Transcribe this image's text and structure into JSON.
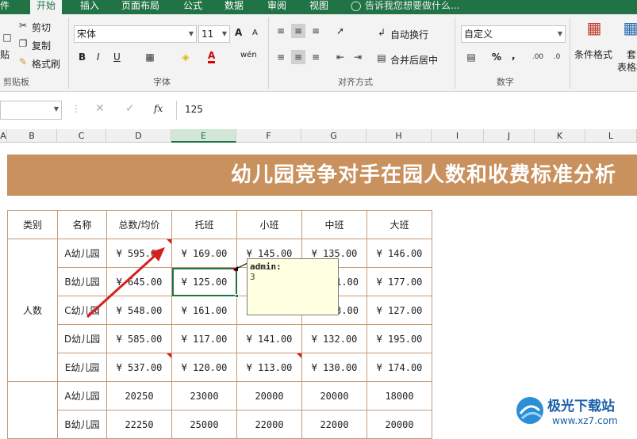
{
  "ribbon_tabs": [
    {
      "label": "件"
    },
    {
      "label": "开始",
      "active": true
    },
    {
      "label": "插入"
    },
    {
      "label": "页面布局"
    },
    {
      "label": "公式"
    },
    {
      "label": "数据"
    },
    {
      "label": "审阅"
    },
    {
      "label": "视图"
    }
  ],
  "tell_me": "告诉我您想要做什么...",
  "clipboard": {
    "cut": "剪切",
    "copy": "复制",
    "format_painter": "格式刷",
    "paste_partial": "贴",
    "group": "剪贴板"
  },
  "font": {
    "name": "宋体",
    "size": "11",
    "group": "字体",
    "bold": "B",
    "italic": "I",
    "underline": "U",
    "grow": "A",
    "shrink": "A",
    "font_color": "A",
    "phonetic": "wén"
  },
  "alignment": {
    "wrap": "自动换行",
    "merge": "合并后居中",
    "group": "对齐方式"
  },
  "number": {
    "format": "自定义",
    "group": "数字",
    "percent": "%",
    "comma": ","
  },
  "styles": {
    "conditional": "条件格式",
    "table_partial": "套",
    "table_partial2": "表格格"
  },
  "formula_bar": {
    "name_box": "",
    "value": "125",
    "fx": "fx"
  },
  "columns": [
    "A",
    "B",
    "C",
    "D",
    "E",
    "F",
    "G",
    "H",
    "I",
    "J",
    "K",
    "L"
  ],
  "banner_title": "幼儿园竞争对手在园人数和收费标准分析",
  "table": {
    "headers": [
      "类别",
      "名称",
      "总数/均价",
      "托班",
      "小班",
      "中班",
      "大班"
    ],
    "group1": "人数",
    "rows": [
      {
        "name": "A幼儿园",
        "total": "¥ 595.00",
        "c1": "¥ 169.00",
        "c2": "¥ 145.00",
        "c3": "¥ 135.00",
        "c4": "¥ 146.00"
      },
      {
        "name": "B幼儿园",
        "total": "¥ 645.00",
        "c1": "¥ 125.00",
        "c2": "",
        "c3": "1.00",
        "c4": "¥ 177.00"
      },
      {
        "name": "C幼儿园",
        "total": "¥ 548.00",
        "c1": "¥ 161.00",
        "c2": "",
        "c3": "3.00",
        "c4": "¥ 127.00"
      },
      {
        "name": "D幼儿园",
        "total": "¥ 585.00",
        "c1": "¥ 117.00",
        "c2": "¥ 141.00",
        "c3": "¥ 132.00",
        "c4": "¥ 195.00"
      },
      {
        "name": "E幼儿园",
        "total": "¥ 537.00",
        "c1": "¥ 120.00",
        "c2": "¥ 113.00",
        "c3": "¥ 130.00",
        "c4": "¥ 174.00"
      },
      {
        "name": "A幼儿园",
        "total": "20250",
        "c1": "23000",
        "c2": "20000",
        "c3": "20000",
        "c4": "18000"
      },
      {
        "name": "B幼儿园",
        "total": "22250",
        "c1": "25000",
        "c2": "22000",
        "c3": "22000",
        "c4": "20000"
      }
    ]
  },
  "comment": {
    "author": "admin:",
    "text": "3"
  },
  "watermark": {
    "site": "极光下载站",
    "url": "www.xz7.com"
  },
  "colors": {
    "excel_green": "#217346",
    "banner": "#c8915e",
    "border": "#c59a77",
    "comment_bg": "#ffffe1",
    "arrow": "#d32020"
  }
}
